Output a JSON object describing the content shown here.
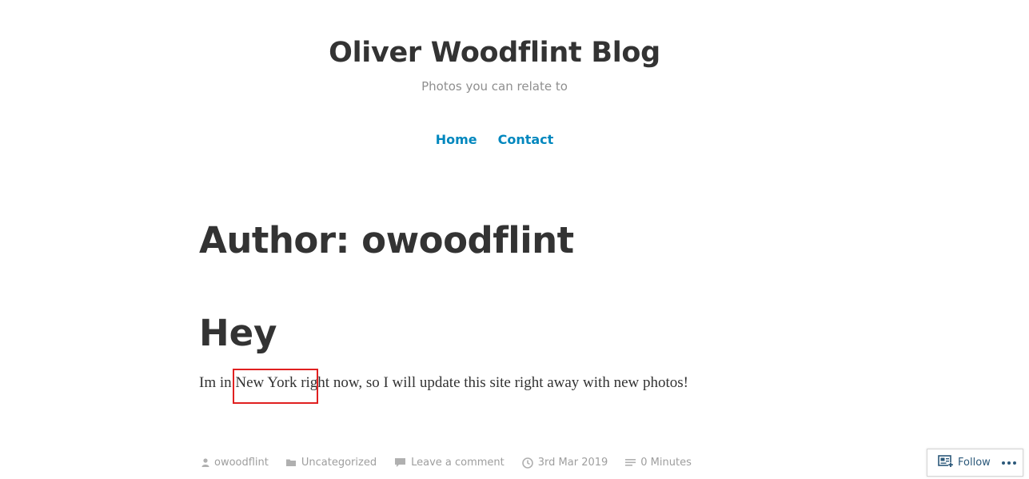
{
  "header": {
    "site_title": "Oliver Woodflint Blog",
    "site_description": "Photos you can relate to"
  },
  "nav": {
    "items": [
      {
        "label": "Home"
      },
      {
        "label": "Contact"
      }
    ]
  },
  "archive": {
    "title": "Author: owoodflint"
  },
  "post": {
    "title": "Hey",
    "body": "Im in New York right now, so I will update this site right away with new photos!",
    "meta": {
      "author": "owoodflint",
      "category": "Uncategorized",
      "comments": "Leave a comment",
      "date": "3rd Mar 2019",
      "reading_time": "0 Minutes"
    }
  },
  "follow_widget": {
    "follow_label": "Follow"
  },
  "colors": {
    "link": "#0087be",
    "text": "#333333",
    "meta": "#9e9e9e",
    "highlight": "#e02020"
  }
}
